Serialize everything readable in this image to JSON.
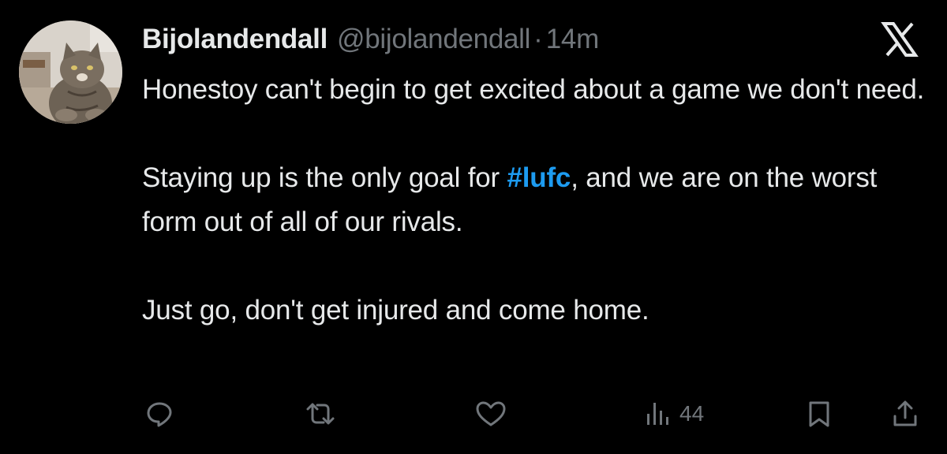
{
  "tweet": {
    "display_name": "Bijolandendall",
    "handle": "@bijolandendall",
    "separator": "·",
    "time": "14m",
    "body": {
      "p1": "Honestoy can't begin to get excited about a game we don't need.",
      "p2_before": "Staying up is the only goal for ",
      "p2_hashtag": "#lufc",
      "p2_after": ", and we are on the worst form out of all of our rivals.",
      "p3": "Just go, don't get injured and come home."
    },
    "actions": {
      "reply_icon": "reply-icon",
      "retweet_icon": "retweet-icon",
      "like_icon": "heart-icon",
      "views_icon": "views-icon",
      "views_count": "44",
      "bookmark_icon": "bookmark-icon",
      "share_icon": "share-icon"
    }
  },
  "colors": {
    "background": "#000000",
    "text": "#e7e9ea",
    "muted": "#71767b",
    "link": "#1d9bf0"
  }
}
